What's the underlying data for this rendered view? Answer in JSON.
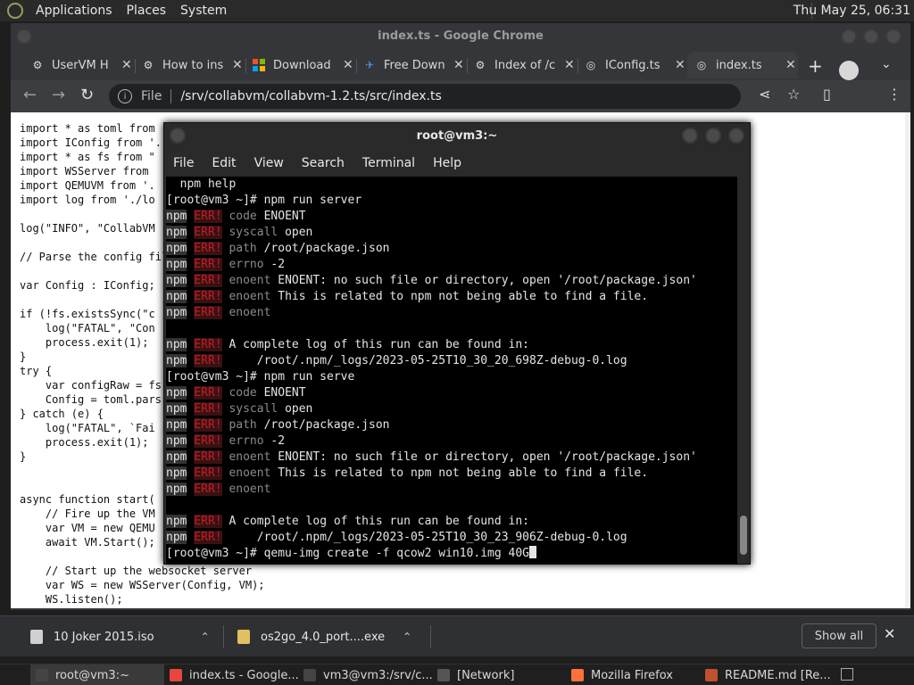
{
  "top_panel": {
    "menus": [
      "Applications",
      "Places",
      "System"
    ],
    "clock": "Thu May 25, 06:31"
  },
  "chrome": {
    "title": "index.ts - Google Chrome",
    "tabs": [
      {
        "label": "UserVM H",
        "icon": "collabvm-icon"
      },
      {
        "label": "How to ins",
        "icon": "collabvm-icon"
      },
      {
        "label": "Download",
        "icon": "windows-logo-icon"
      },
      {
        "label": "Free Down",
        "icon": "flame-icon"
      },
      {
        "label": "Index of /c",
        "icon": "collabvm-icon"
      },
      {
        "label": "IConfig.ts",
        "icon": "globe-icon"
      },
      {
        "label": "index.ts",
        "icon": "globe-icon"
      }
    ],
    "address": {
      "scheme": "File",
      "path": "/srv/collabvm/collabvm-1.2.ts/src/index.ts"
    }
  },
  "page": {
    "code_lines": [
      "import * as toml from",
      "import IConfig from '.",
      "import * as fs from \"",
      "import WSServer from",
      "import QEMUVM from '.",
      "import log from './lo",
      "",
      "log(\"INFO\", \"CollabVM",
      "",
      "// Parse the config fil",
      "",
      "var Config : IConfig;",
      "",
      "if (!fs.existsSync(\"c",
      "    log(\"FATAL\", \"Con",
      "    process.exit(1);",
      "}",
      "try {",
      "    var configRaw = fs",
      "    Config = toml.pars",
      "} catch (e) {",
      "    log(\"FATAL\", `Fai",
      "    process.exit(1);",
      "}",
      "",
      "",
      "async function start(",
      "    // Fire up the VM",
      "    var VM = new QEMU",
      "    await VM.Start();",
      "",
      "    // Start up the websocket server",
      "    var WS = new WSServer(Config, VM);",
      "    WS.listen();"
    ]
  },
  "terminal": {
    "title": "root@vm3:~",
    "menus": [
      "File",
      "Edit",
      "Search",
      "Terminal",
      "Help"
    ],
    "lines": [
      {
        "kind": "plain",
        "text": "  npm help"
      },
      {
        "kind": "plain",
        "text": "[root@vm3 ~]# npm run server"
      },
      {
        "kind": "err",
        "key": "code",
        "msg": "ENOENT"
      },
      {
        "kind": "err",
        "key": "syscall",
        "msg": "open"
      },
      {
        "kind": "err",
        "key": "path",
        "msg": "/root/package.json"
      },
      {
        "kind": "err",
        "key": "errno",
        "msg": "-2"
      },
      {
        "kind": "err",
        "key": "enoent",
        "msg": "ENOENT: no such file or directory, open '/root/package.json'"
      },
      {
        "kind": "err",
        "key": "enoent",
        "msg": "This is related to npm not being able to find a file."
      },
      {
        "kind": "err",
        "key": "enoent",
        "msg": ""
      },
      {
        "kind": "plain",
        "text": ""
      },
      {
        "kind": "err",
        "key": "",
        "msg": "A complete log of this run can be found in:"
      },
      {
        "kind": "err",
        "key": "",
        "msg": "    /root/.npm/_logs/2023-05-25T10_30_20_698Z-debug-0.log"
      },
      {
        "kind": "plain",
        "text": "[root@vm3 ~]# npm run serve"
      },
      {
        "kind": "err",
        "key": "code",
        "msg": "ENOENT"
      },
      {
        "kind": "err",
        "key": "syscall",
        "msg": "open"
      },
      {
        "kind": "err",
        "key": "path",
        "msg": "/root/package.json"
      },
      {
        "kind": "err",
        "key": "errno",
        "msg": "-2"
      },
      {
        "kind": "err",
        "key": "enoent",
        "msg": "ENOENT: no such file or directory, open '/root/package.json'"
      },
      {
        "kind": "err",
        "key": "enoent",
        "msg": "This is related to npm not being able to find a file."
      },
      {
        "kind": "err",
        "key": "enoent",
        "msg": ""
      },
      {
        "kind": "plain",
        "text": ""
      },
      {
        "kind": "err",
        "key": "",
        "msg": "A complete log of this run can be found in:"
      },
      {
        "kind": "err",
        "key": "",
        "msg": "    /root/.npm/_logs/2023-05-25T10_30_23_906Z-debug-0.log"
      },
      {
        "kind": "prompt",
        "text": "[root@vm3 ~]# qemu-img create -f qcow2 win10.img 40G"
      }
    ],
    "npm_tag": "npm",
    "err_tag": "ERR!"
  },
  "downloads": {
    "items": [
      {
        "name": "10 Joker 2015.iso"
      },
      {
        "name": "os2go_4.0_port....exe"
      }
    ],
    "show_all": "Show all"
  },
  "taskbar": {
    "items": [
      {
        "label": "root@vm3:~",
        "icon_color": "#444"
      },
      {
        "label": "index.ts - Google...",
        "icon_color": "#e8453c"
      },
      {
        "label": "vm3@vm3:/srv/c...",
        "icon_color": "#444"
      },
      {
        "label": "[Network]",
        "icon_color": "#555"
      },
      {
        "label": "Mozilla Firefox",
        "icon_color": "#ff7139"
      },
      {
        "label": "README.md [Re...",
        "icon_color": "#c05030"
      }
    ]
  },
  "colors": {
    "error_red": "#c01c28",
    "terminal_bg": "#000000",
    "chrome_bg": "#35363a"
  }
}
